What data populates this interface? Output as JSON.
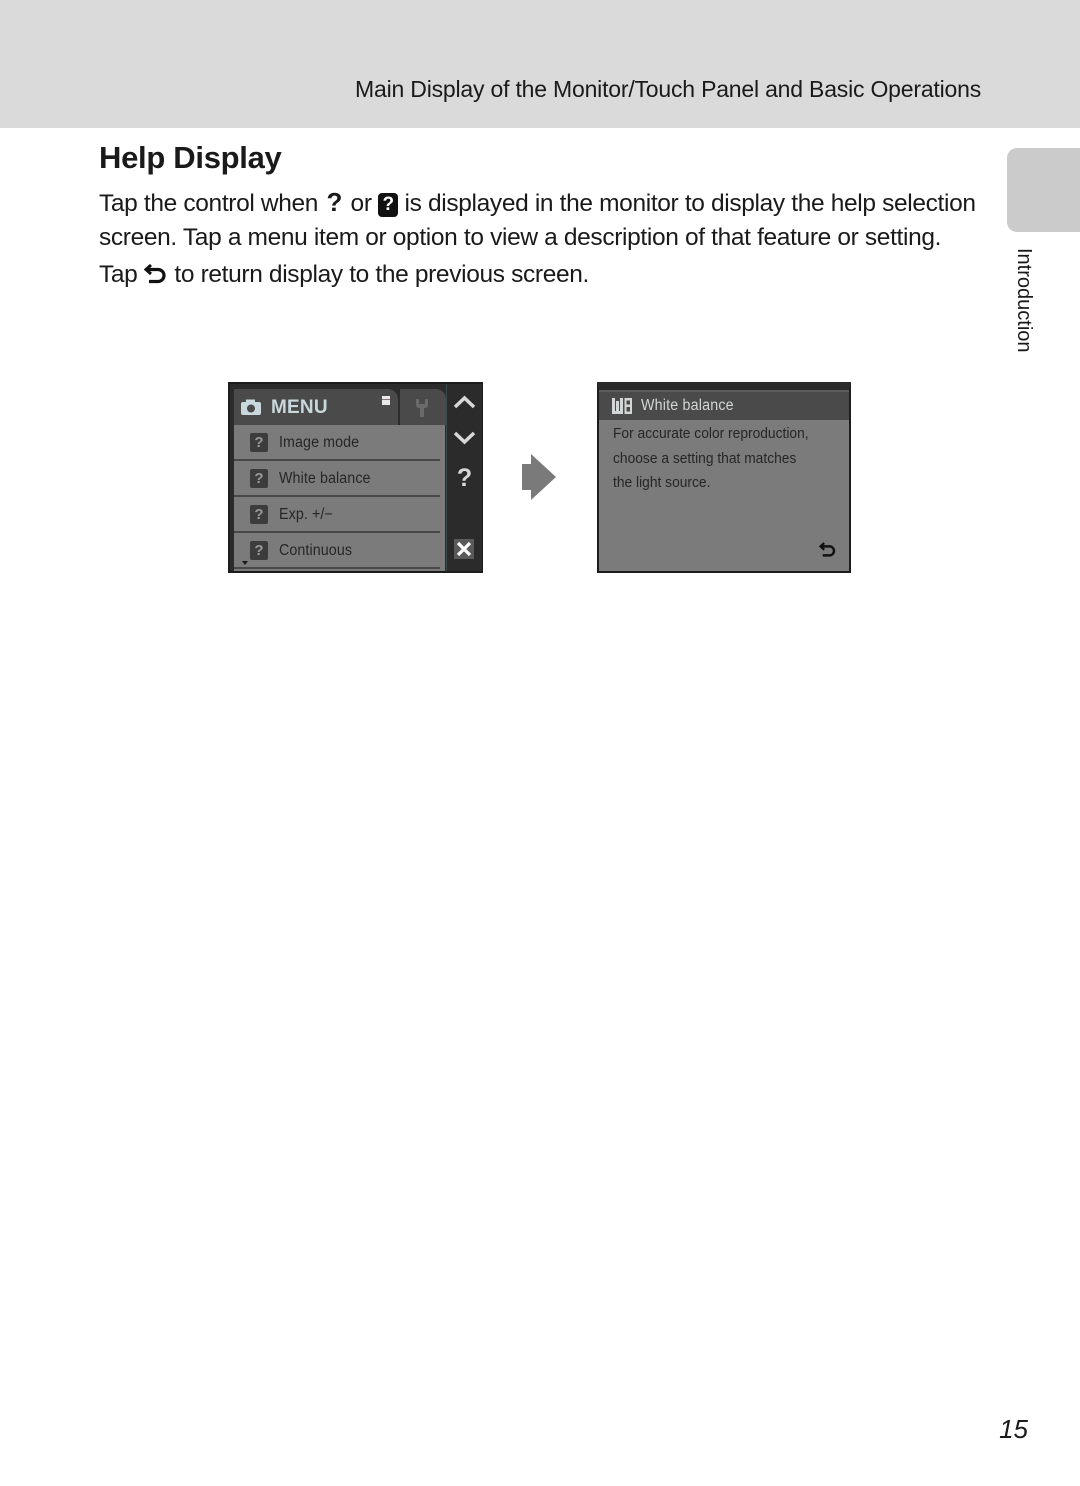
{
  "header": {
    "section_title": "Main Display of the Monitor/Touch Panel and Basic Operations"
  },
  "side_tab": {
    "label": "Introduction"
  },
  "page": {
    "title": "Help Display",
    "number": "15"
  },
  "body": {
    "para1_part1": "Tap the control when ",
    "para1_icon1": "help-question-icon",
    "para1_part2": " or ",
    "para1_icon2": "help-box-icon",
    "para1_part3": " is displayed in the monitor to display the help selection screen. Tap a menu item or option to view a description of that feature or setting.",
    "para2_part1": "Tap ",
    "para2_icon": "return-icon",
    "para2_part2": " to return display to the previous screen."
  },
  "icons": {
    "question_glyph": "?",
    "help_box_glyph": "?",
    "close_glyph": "✕"
  },
  "menu_screen": {
    "tab_label": "MENU",
    "items": [
      {
        "label": "Image mode",
        "icon": "help-box-icon"
      },
      {
        "label": "White balance",
        "icon": "help-box-icon"
      },
      {
        "label": "Exp. +/−",
        "icon": "help-box-icon"
      },
      {
        "label": "Continuous",
        "icon": "help-box-icon"
      }
    ],
    "controls": [
      "scroll-up",
      "scroll-down",
      "help",
      "close"
    ]
  },
  "help_screen": {
    "title": "White balance",
    "description": "For accurate color reproduction,\nchoose a setting that matches\nthe light source."
  },
  "colors": {
    "header_band": "#dadada",
    "side_tab": "#cbcbcb",
    "screen_dark": "#2b2b2b",
    "screen_list": "#7b7b7b",
    "arrow": "#7a7a7a"
  }
}
